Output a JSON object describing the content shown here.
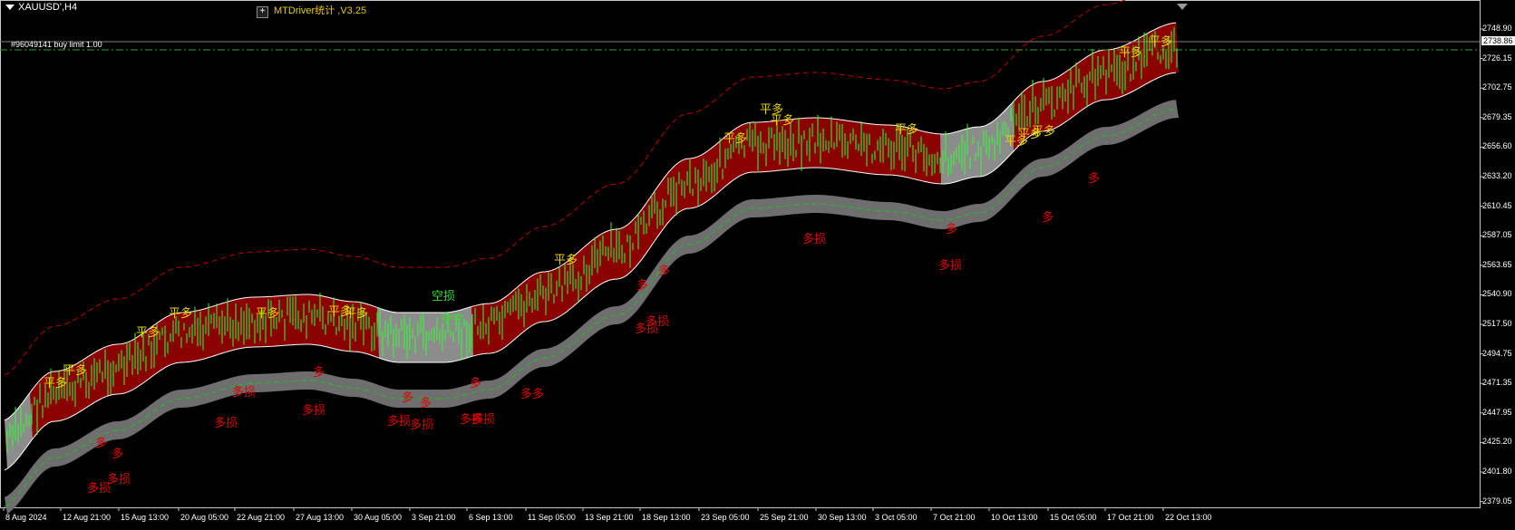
{
  "window": {
    "symbol_label": "XAUUSD',H4"
  },
  "expert": {
    "label": "MTDriver统计 ,V3.25"
  },
  "order_line": {
    "label": "#96049141 buy limit 1.00"
  },
  "price_axis": {
    "ticks": [
      "2748.90",
      "2726.15",
      "2702.75",
      "2679.35",
      "2656.60",
      "2633.20",
      "2610.45",
      "2587.05",
      "2563.65",
      "2540.90",
      "2517.50",
      "2494.75",
      "2471.35",
      "2447.95",
      "2425.20",
      "2401.80",
      "2379.05"
    ],
    "current_price": "2738.86"
  },
  "time_axis": {
    "ticks": [
      "8 Aug 2024",
      "12 Aug 21:00",
      "15 Aug 13:00",
      "20 Aug 05:00",
      "22 Aug 21:00",
      "27 Aug 13:00",
      "30 Aug 05:00",
      "3 Sep 21:00",
      "6 Sep 13:00",
      "11 Sep 05:00",
      "13 Sep 21:00",
      "18 Sep 13:00",
      "23 Sep 05:00",
      "25 Sep 21:00",
      "30 Sep 13:00",
      "3 Oct 05:00",
      "7 Oct 21:00",
      "10 Oct 13:00",
      "15 Oct 05:00",
      "17 Oct 21:00",
      "22 Oct 13:00"
    ]
  },
  "signals": {
    "yellow": [
      "平多",
      "平多",
      "平多",
      "平多",
      "平多",
      "平多",
      "平多",
      "平多",
      "平多",
      "平多",
      "平多",
      "平多",
      "平多",
      "平多",
      "平多",
      "平多",
      "平多"
    ],
    "green": [
      "空损",
      "空空"
    ],
    "red": [
      "多损",
      "多损",
      "多",
      "多",
      "多损",
      "多损",
      "多",
      "多损",
      "多",
      "多",
      "多损",
      "多损",
      "多损",
      "多损",
      "多",
      "多多",
      "多损",
      "多损",
      "多",
      "多",
      "多损",
      "多损",
      "多",
      "多",
      "多"
    ]
  },
  "colors": {
    "band_fill": "#8b0000",
    "band_neutral": "#8c8c8c",
    "lower_band": "#6e6e6e",
    "bull_candle": "#32ff32",
    "signal_yellow": "#e8d400",
    "signal_red": "#e00000",
    "signal_green": "#30e030"
  }
}
